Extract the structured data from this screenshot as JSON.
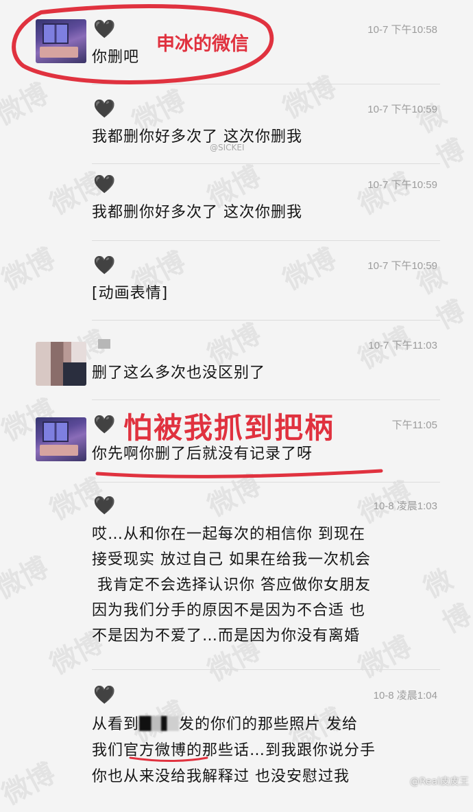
{
  "messages": [
    {
      "heart": "🖤",
      "time": "10-7 下午10:58",
      "text": "你删吧"
    },
    {
      "heart": "🖤",
      "time": "10-7 下午10:59",
      "text": "我都删你好多次了 这次你删我"
    },
    {
      "heart": "🖤",
      "time": "10-7 下午10:59",
      "text": "我都删你好多次了 这次你删我"
    },
    {
      "heart": "🖤",
      "time": "10-7 下午10:59",
      "text": "[动画表情]"
    },
    {
      "time": "10-7 下午11:03",
      "text": "删了这么多次也没区别了"
    },
    {
      "heart": "🖤",
      "time": "下午11:05",
      "text": "你先啊你删了后就没有记录了呀"
    },
    {
      "heart": "🖤",
      "time": "10-8 凌晨1:03",
      "text": "哎…从和你在一起每次的相信你 到现在\n接受现实 放过自己 如果在给我一次机会\n 我肯定不会选择认识你 答应做你女朋友\n因为我们分手的原因不是因为不合适 也\n不是因为不爱了…而是因为你没有离婚"
    },
    {
      "heart": "🖤",
      "time": "10-8 凌晨1:04",
      "text_a": "从看到",
      "text_b": "发的你们的那些照片 发给",
      "text_c": "我们官方微博的那些话…到我跟你说分手",
      "text_d": "你也从来没给我解释过 也没安慰过我"
    }
  ],
  "annotations": {
    "label1": "申冰的微信",
    "label2": "怕被我抓到把柄"
  },
  "watermark": {
    "text": "微博",
    "handle": "@SICKEI",
    "footer": "@Real皮皮王"
  },
  "colors": {
    "annotation": "#e0323f",
    "background": "#f4f4f4"
  }
}
